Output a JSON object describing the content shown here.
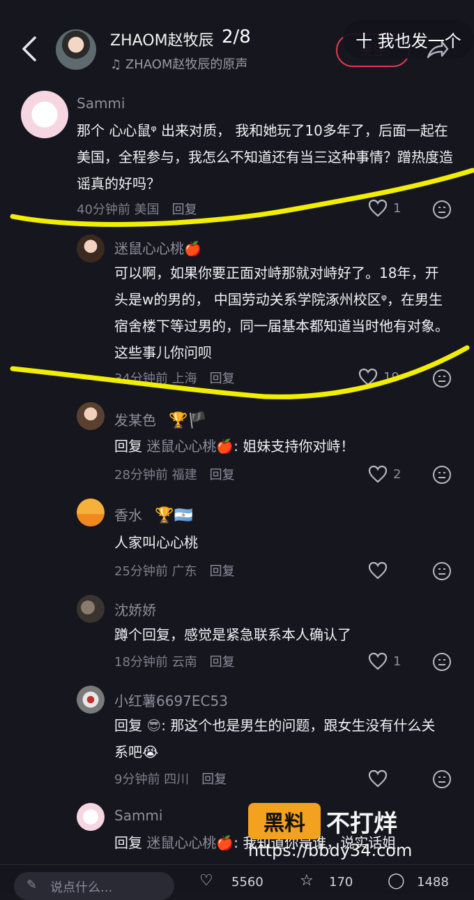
{
  "header": {
    "page_counter": "2/8",
    "author": "ZHAOM赵牧辰",
    "sound": "ZHAOM赵牧辰的原声",
    "follow_label": "关注",
    "post_label": "十 我也发一个"
  },
  "comments": [
    {
      "name": "Sammi",
      "text": "那个 心心鼠ᵠ 出来对质， 我和她玩了10多年了，后面一起在美国，全程参与，我怎么不知道还有当三这种事情？蹭热度造谣真的好吗？",
      "time": "40分钟前 美国",
      "reply": "回复",
      "likes": "1"
    },
    {
      "name": "迷鼠心心桃🍎",
      "text": "可以啊，如果你要正面对峙那就对峙好了。18年，开头是w的男的， 中国劳动关系学院涿州校区ᵠ，在男生宿舍楼下等过男的，同一届基本都知道当时他有对象。这些事儿你问呗",
      "time": "34分钟前 上海",
      "reply": "回复",
      "likes": "19"
    },
    {
      "name": "发某色",
      "badge": "🏆🏴",
      "prefix": "回复",
      "mention": "迷鼠心心桃🍎",
      "text": ": 姐妹支持你对峙！",
      "time": "28分钟前 福建",
      "reply": "回复",
      "likes": "2"
    },
    {
      "name": "香水",
      "badge": "🏆🇦🇷",
      "text": "人家叫心心桃",
      "time": "25分钟前 广东",
      "reply": "回复",
      "likes": ""
    },
    {
      "name": "沈娇娇",
      "text": "蹲个回复，感觉是紧急联系本人确认了",
      "time": "18分钟前 云南",
      "reply": "回复",
      "likes": "1"
    },
    {
      "name": "小红薯6697EC53",
      "prefix": "回复",
      "mention": "😎",
      "text": ": 那这个也是男生的问题，跟女生没有什么关系吧😭",
      "time": "9分钟前 四川",
      "reply": "回复",
      "likes": ""
    },
    {
      "name": "Sammi",
      "prefix": "回复",
      "mention": "迷鼠心心桃🍎",
      "text": ": 我知道你是谁，说实话姐"
    }
  ],
  "watermark": {
    "badge": "黑料",
    "text": "不打烊",
    "url": "https://bbdy34.com"
  },
  "bottom": {
    "input_placeholder": "说点什么...",
    "likes": "5560",
    "collects": "170",
    "comments": "1488"
  },
  "colors": {
    "background": "#16161e",
    "highlight": "#f2ee00",
    "follow": "#e0394f",
    "watermark_badge": "#f2a21e"
  }
}
